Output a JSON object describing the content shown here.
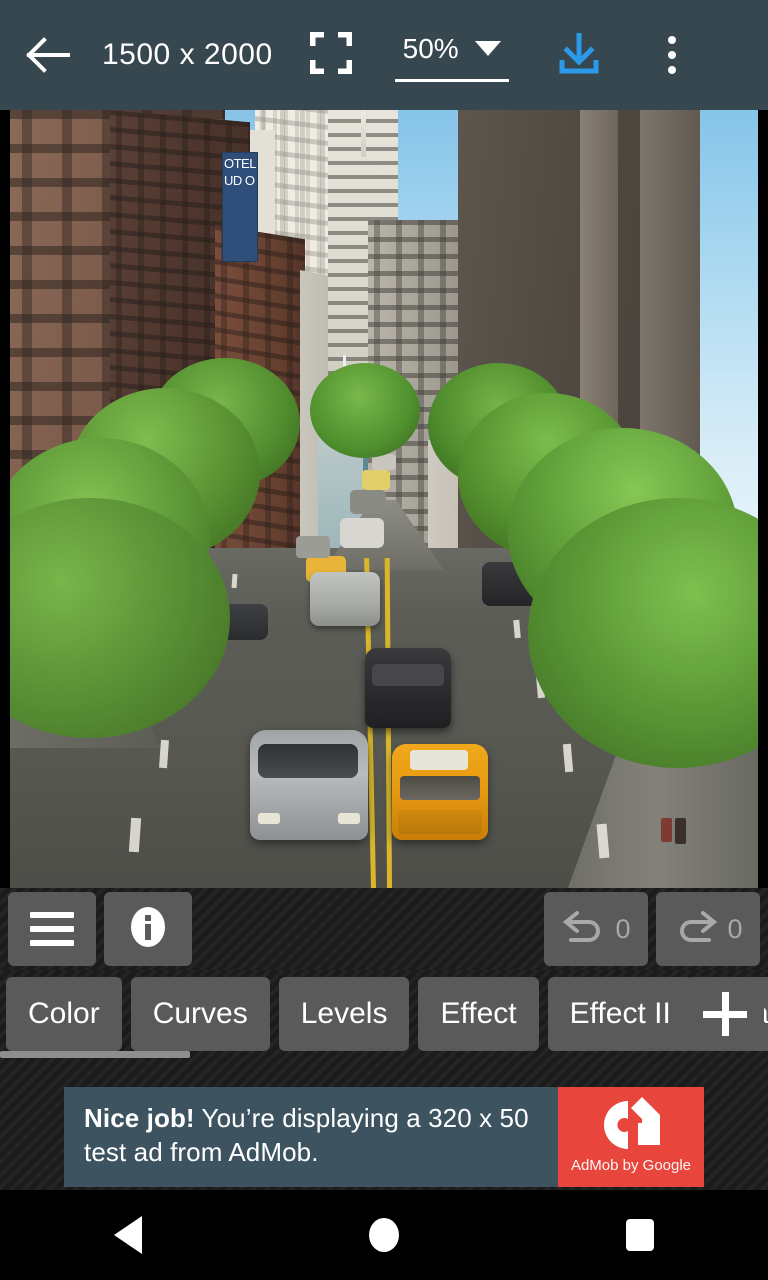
{
  "topbar": {
    "back_icon": "arrow-left-icon",
    "dimensions": "1500 x 2000",
    "fit_icon": "fit-to-screen-icon",
    "zoom_value": "50%",
    "zoom_dropdown_icon": "chevron-down-icon",
    "save_icon": "download-icon",
    "more_icon": "overflow-menu-icon",
    "bg_color": "#37474f",
    "accent_color": "#2b9ae8"
  },
  "canvas": {
    "photo_description": "Aerial view of a Manhattan street lined with trees and tall buildings, yellow taxi and cars on the roadway",
    "signage": "OTEL\nUD\nO"
  },
  "tools": {
    "menu_label": "menu-icon",
    "info_label": "info-icon",
    "undo_label": "undo-icon",
    "undo_count": "0",
    "redo_label": "redo-icon",
    "redo_count": "0"
  },
  "tabs": {
    "items": [
      {
        "label": "Color"
      },
      {
        "label": "Curves"
      },
      {
        "label": "Levels"
      },
      {
        "label": "Effect"
      },
      {
        "label": "Effect II"
      },
      {
        "label": "Fra"
      }
    ],
    "add_label": "plus-icon"
  },
  "ad": {
    "headline": "Nice job!",
    "body": " You’re displaying a 320 x 50 test ad from AdMob.",
    "brand": "AdMob by Google",
    "bg_color": "#3d5360",
    "logo_color": "#e8453c"
  },
  "navbar": {
    "back": "android-back-icon",
    "home": "android-home-icon",
    "recents": "android-recents-icon"
  }
}
